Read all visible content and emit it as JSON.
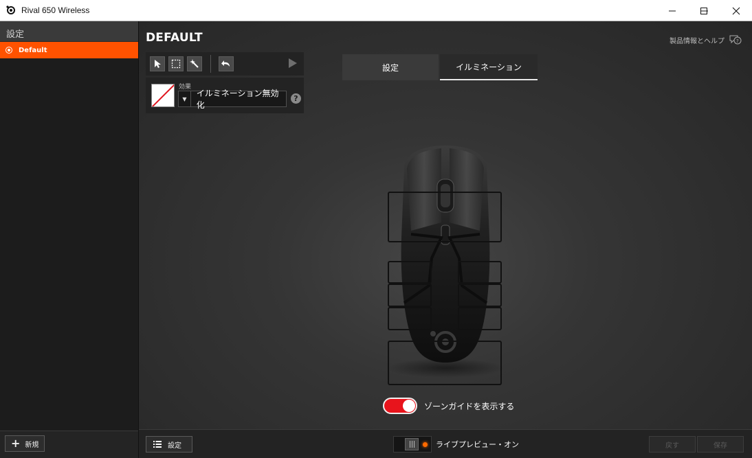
{
  "window": {
    "title": "Rival 650 Wireless"
  },
  "sidebar": {
    "header": "設定",
    "profiles": [
      {
        "label": "Default",
        "selected": true
      }
    ],
    "new_button": "新規"
  },
  "main": {
    "page_title": "DEFAULT",
    "help_link": "製品情報とヘルプ",
    "effect": {
      "label": "効果",
      "value": "イルミネーション無効化",
      "help": "?"
    },
    "tabs": [
      {
        "label": "設定",
        "active": false
      },
      {
        "label": "イルミネーション",
        "active": true
      }
    ],
    "zone_guide": {
      "label": "ゾーンガイドを表示する",
      "enabled": true
    }
  },
  "bottom_bar": {
    "settings_button": "設定",
    "live_preview": "ライブプレビュー・オン",
    "revert_button": "戻す",
    "save_button": "保存"
  },
  "colors": {
    "accent": "#ff5200",
    "toggle_on": "#e8141c"
  }
}
